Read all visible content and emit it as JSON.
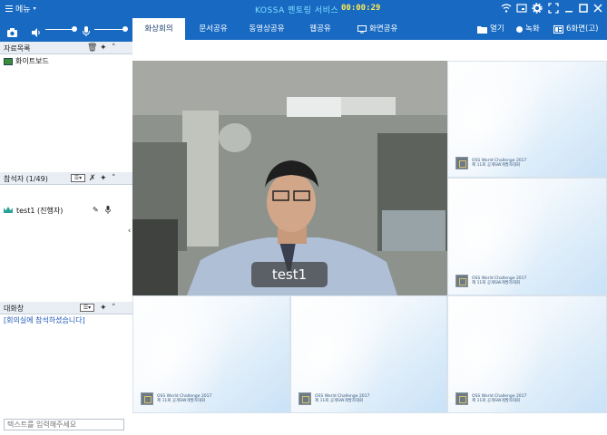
{
  "titlebar": {
    "menu_label": "메뉴",
    "title": "KOSSA 멘토링 서비스",
    "timer": "00:00:29"
  },
  "panels": {
    "files": {
      "title": "자료목록",
      "items": [
        "화이트보드"
      ]
    },
    "participants": {
      "title": "참석자 (1/49)",
      "items": [
        {
          "name": "test1 (진행자)"
        }
      ]
    },
    "chat": {
      "title": "대화창",
      "notice": "[회의실에 참석하셨습니다]",
      "input_placeholder": "텍스트를 입력해주세요"
    }
  },
  "tabs": [
    {
      "label": "화상회의",
      "active": true
    },
    {
      "label": "문서공유",
      "active": false
    },
    {
      "label": "동영상공유",
      "active": false
    },
    {
      "label": "웹공유",
      "active": false
    },
    {
      "label": "화면공유",
      "active": false
    }
  ],
  "tools": {
    "open_label": "열기",
    "record_label": "녹화",
    "layout_label": "6화면(고)"
  },
  "video": {
    "participant_name": "test1"
  },
  "logo": {
    "line1": "OSS World Challenge 2017",
    "line2": "제 11회 공개SW개발자대회"
  },
  "colors": {
    "titlebar": "#1769c2",
    "accent_time": "#ffe94d",
    "title_text": "#7fe0ff"
  }
}
